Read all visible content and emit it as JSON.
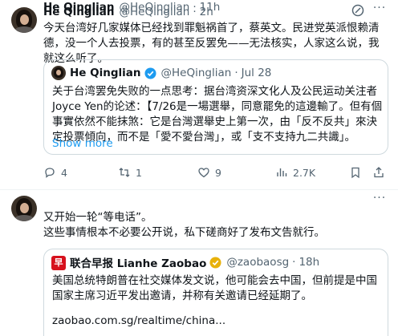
{
  "tweets": [
    {
      "name": "He Qinglian",
      "handle": "@HeQinglian",
      "separator": "·",
      "time": "2h",
      "text": "今天台湾好几家媒体已经找到罪魁祸首了，蔡英文。民进党英派恨赖清德，没一个人去投票，有的甚至反罢免——无法核实，人家这么说，我就这么听了。",
      "quote": {
        "name": "He Qinglian",
        "handle": "@HeQinglian",
        "separator": "·",
        "time": "Jul 28",
        "text": "关于台湾罢免失败的一点思考：据台湾资深文化人及公民运动关注者Joyce Yen的论述：【7/26是一場選舉，同意罷免的這邊輸了。但有個事實依然不能抹煞：它是台灣選舉史上第一次，由「反不反共」來決定投票傾向，而不是「愛不愛台灣」，或「支不支持九二共識」。",
        "show_more": "Show more"
      },
      "actions": {
        "reply": "4",
        "retweet": "1",
        "like": "9",
        "views": "2.7K"
      }
    },
    {
      "name": "He Qinglian",
      "handle": "@HeQinglian",
      "separator": "·",
      "time": "11h",
      "text": "又开始一轮“等电话”。\n这些事情根本不必要公开说，私下磋商好了发布文告就行。",
      "quote": {
        "name": "联合早报 Lianhe Zaobao",
        "logo_char": "早",
        "handle": "@zaobaosg",
        "separator": "·",
        "time": "18h",
        "text": "美国总统特朗普在社交媒体发文说，他可能会去中国，但前提是中国国家主席习近平发出邀请，并称有关邀请已经延期了。",
        "link": "zaobao.com.sg/realtime/china..."
      }
    }
  ],
  "icons": [
    "more-icon",
    "slash-icon",
    "verified-icon",
    "reply-icon",
    "retweet-icon",
    "like-icon",
    "views-icon",
    "bookmark-icon",
    "share-icon"
  ],
  "colors": {
    "link": "#1d9bf0",
    "muted": "#536471",
    "border": "#cfd9de",
    "verified": "#1d9bf0",
    "zaobao_red": "#d7111d"
  }
}
